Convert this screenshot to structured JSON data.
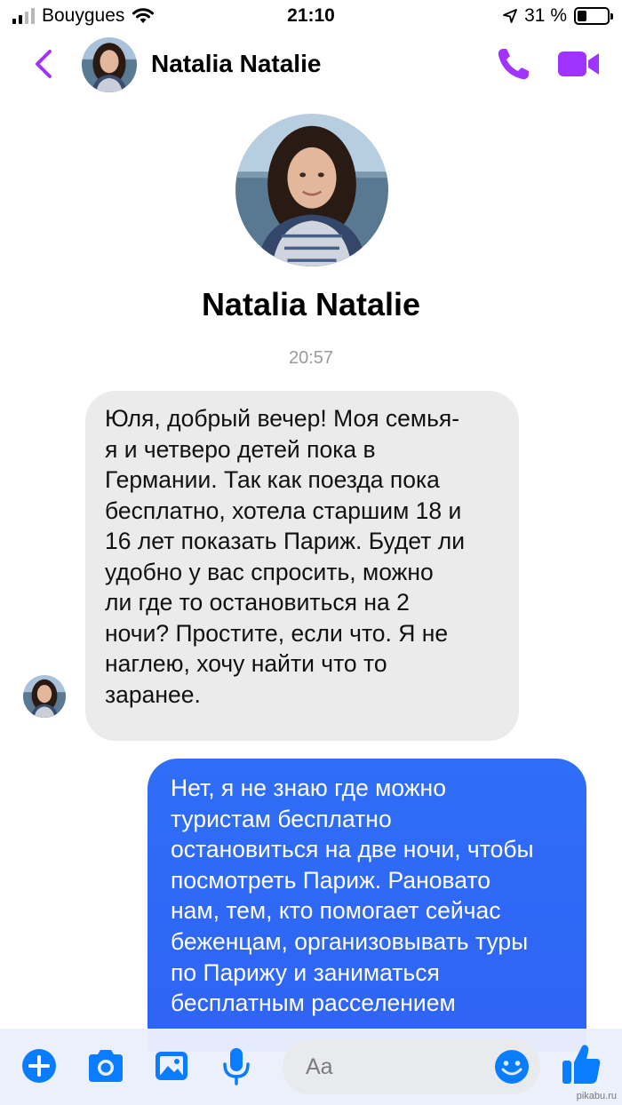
{
  "status_bar": {
    "carrier": "Bouygues",
    "time": "21:10",
    "battery_text": "31 %",
    "battery_level": 0.31
  },
  "header": {
    "contact_name": "Natalia Natalie",
    "icons": [
      "back-chevron-icon",
      "phone-icon",
      "video-camera-icon"
    ],
    "accent_color": "#a033ff"
  },
  "profile": {
    "name": "Natalia Natalie"
  },
  "conversation": {
    "timestamp": "20:57",
    "incoming": {
      "lines": [
        "Юля, добрый вечер! Моя семья-",
        "я и четверо детей пока в",
        "Германии. Так как поезда пока",
        "бесплатно, хотела старшим 18 и",
        "16 лет показать Париж. Будет ли",
        "удобно у вас спросить, можно",
        "ли где то остановиться на 2",
        "ночи? Простите, если что. Я не",
        "наглею, хочу найти что то",
        "заранее."
      ]
    },
    "outgoing": {
      "lines": [
        "Нет, я не знаю где можно",
        "туристам бесплатно",
        "остановиться на две ночи, чтобы",
        "посмотреть Париж. Рановато",
        "нам, тем, кто помогает сейчас",
        "беженцам, организовывать туры",
        "по Парижу и заниматься",
        "бесплатным расселением"
      ],
      "bubble_color": "#2f6ef7"
    }
  },
  "composer": {
    "placeholder": "Aa",
    "icons": [
      "plus-icon",
      "camera-icon",
      "gallery-icon",
      "microphone-icon",
      "emoji-icon",
      "thumbs-up-icon"
    ],
    "accent_color": "#0a7cff"
  },
  "watermark": "pikabu.ru"
}
